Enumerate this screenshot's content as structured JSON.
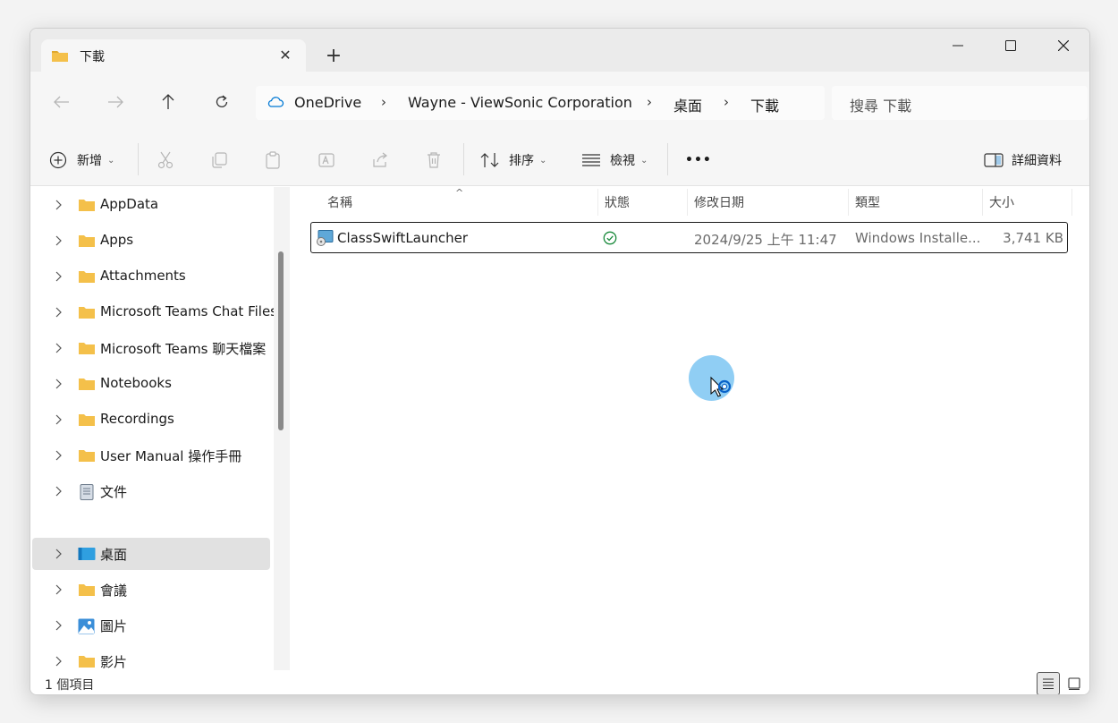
{
  "tab": {
    "title": "下載",
    "close": "✕",
    "new_tab": "+"
  },
  "window_controls": {
    "minimize": "─",
    "maximize": "☐",
    "close": "✕"
  },
  "breadcrumb": {
    "items": [
      "OneDrive",
      "Wayne - ViewSonic Corporation",
      "桌面",
      "下載"
    ],
    "separator": "›"
  },
  "search": {
    "placeholder": "搜尋 下載"
  },
  "toolbar": {
    "new_label": "新增",
    "sort_label": "排序",
    "view_label": "檢視",
    "more_label": "•••",
    "details_label": "詳細資料"
  },
  "sidebar": {
    "items": [
      {
        "label": "AppData",
        "icon": "folder-icon"
      },
      {
        "label": "Apps",
        "icon": "folder-icon"
      },
      {
        "label": "Attachments",
        "icon": "folder-icon"
      },
      {
        "label": "Microsoft Teams Chat Files",
        "icon": "folder-icon"
      },
      {
        "label": "Microsoft Teams 聊天檔案",
        "icon": "folder-icon"
      },
      {
        "label": "Notebooks",
        "icon": "folder-icon"
      },
      {
        "label": "Recordings",
        "icon": "folder-icon"
      },
      {
        "label": "User Manual 操作手冊",
        "icon": "folder-icon"
      },
      {
        "label": "文件",
        "icon": "documents-icon"
      },
      {
        "label": "桌面",
        "icon": "desktop-icon",
        "selected": true
      },
      {
        "label": "會議",
        "icon": "folder-icon"
      },
      {
        "label": "圖片",
        "icon": "pictures-icon"
      },
      {
        "label": "影片",
        "icon": "folder-icon"
      }
    ]
  },
  "columns": {
    "name": "名稱",
    "status": "狀態",
    "modified": "修改日期",
    "type": "類型",
    "size": "大小"
  },
  "files": [
    {
      "name": "ClassSwiftLauncher",
      "status_icon": "synced-check-icon",
      "modified": "2024/9/25 上午 11:47",
      "type": "Windows Installe...",
      "size": "3,741 KB"
    }
  ],
  "statusbar": {
    "count_text": "1 個項目"
  },
  "colors": {
    "folder": "#f4c04a",
    "accent": "#0078d4",
    "status_ok": "#1a8a3c",
    "cursor_halo": "#7cc6f2"
  }
}
